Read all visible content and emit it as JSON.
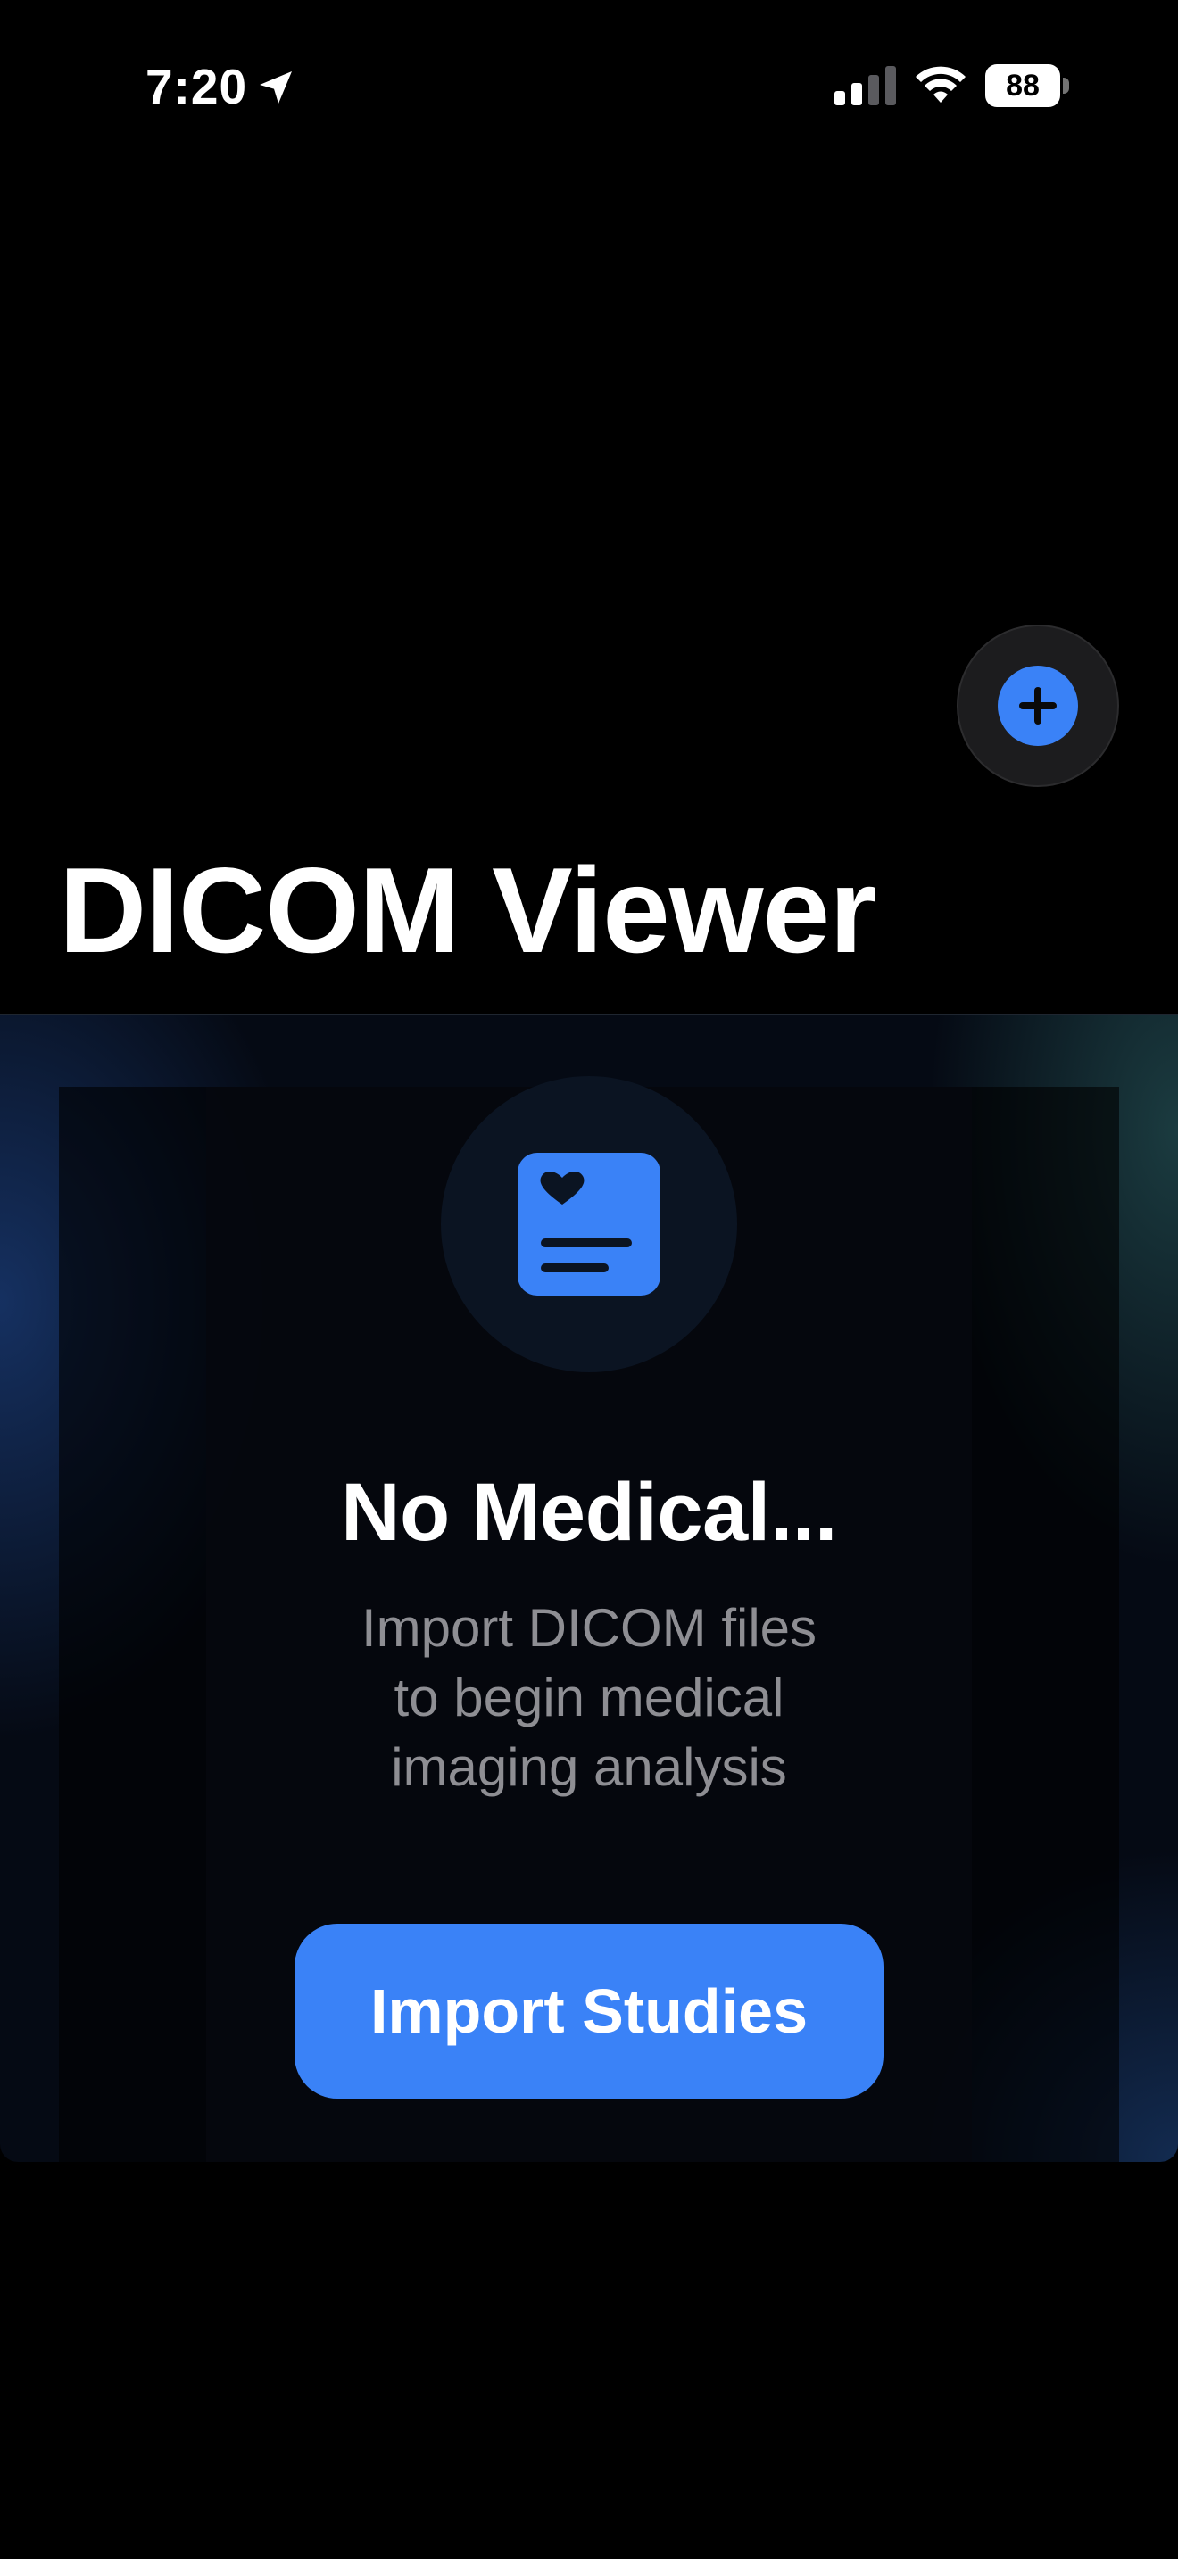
{
  "status_bar": {
    "time": "7:20",
    "battery_level": "88",
    "icons": [
      "location-arrow-icon",
      "cellular-signal-icon",
      "wifi-icon",
      "battery-icon"
    ]
  },
  "header": {
    "title": "DICOM Viewer",
    "add_button_icon": "plus-circle-icon"
  },
  "empty_state": {
    "icon": "medical-record-icon",
    "title": "No Medical...",
    "subtitle_lines": [
      "Import DICOM files",
      "to begin medical",
      "imaging analysis"
    ],
    "import_button_label": "Import Studies"
  },
  "colors": {
    "accent": "#3a82f7",
    "background": "#000000",
    "subtitle": "#8e8e93",
    "icon_circle": "#0b1422"
  }
}
